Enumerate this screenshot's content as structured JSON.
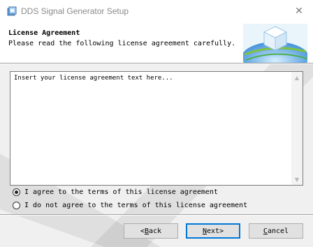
{
  "window": {
    "title": "DDS Signal Generator Setup",
    "close_glyph": "✕"
  },
  "header": {
    "title": "License Agreement",
    "subtitle": "Please read the following license agreement carefully.",
    "graphic": "installer-globe-graphic"
  },
  "license": {
    "text": "Insert your license agreement text here...",
    "scroll_up_glyph": "▲",
    "scroll_down_glyph": "▼"
  },
  "options": [
    {
      "label": "I agree to the terms of this license agreement",
      "selected": true
    },
    {
      "label": "I do not agree to the terms of this license agreement",
      "selected": false
    }
  ],
  "buttons": {
    "back": {
      "prefix": "< ",
      "mnemonic": "B",
      "rest": "ack"
    },
    "next": {
      "mnemonic": "N",
      "rest": "ext",
      "suffix": " >"
    },
    "cancel": {
      "mnemonic": "C",
      "rest": "ancel"
    }
  },
  "colors": {
    "accent": "#0078d7",
    "background": "#f0f0f0"
  }
}
